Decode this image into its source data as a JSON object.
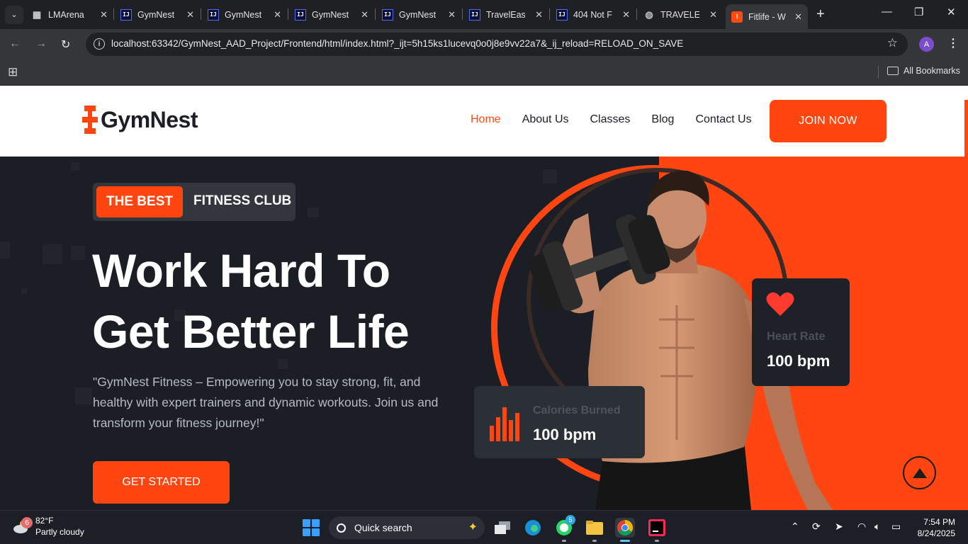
{
  "browser": {
    "tabs": [
      {
        "title": "LMArena",
        "favicon": "grid-icon"
      },
      {
        "title": "GymNest",
        "favicon": "intellij-icon"
      },
      {
        "title": "GymNest",
        "favicon": "intellij-icon"
      },
      {
        "title": "GymNest",
        "favicon": "intellij-icon"
      },
      {
        "title": "GymNest",
        "favicon": "intellij-icon"
      },
      {
        "title": "TravelEase",
        "favicon": "intellij-icon"
      },
      {
        "title": "404 Not F",
        "favicon": "intellij-icon"
      },
      {
        "title": "TRAVELER",
        "favicon": "globe-icon"
      },
      {
        "title": "Fitlife - W",
        "favicon": "fitlife-icon"
      }
    ],
    "url": "localhost:63342/GymNest_AAD_Project/Frontend/html/index.html?_ijt=5h15ks1lucevq0o0j8e9vv22a7&_ij_reload=RELOAD_ON_SAVE",
    "profile_initial": "A",
    "bookmarks_label": "All Bookmarks"
  },
  "site": {
    "brand": "GymNest",
    "nav": [
      {
        "label": "Home",
        "active": true
      },
      {
        "label": "About Us",
        "active": false
      },
      {
        "label": "Classes",
        "active": false
      },
      {
        "label": "Blog",
        "active": false
      },
      {
        "label": "Contact Us",
        "active": false
      }
    ],
    "join_label": "JOIN NOW",
    "hero": {
      "badge_highlight": "THE BEST",
      "badge_rest": "FITNESS CLUB",
      "headline_line1": "Work Hard To",
      "headline_line2": "Get Better Life",
      "lead": "\"GymNest Fitness – Empowering you to stay strong, fit, and healthy with expert trainers and dynamic workouts. Join us and transform your fitness journey!\"",
      "cta_label": "GET STARTED"
    },
    "stats": {
      "heart_rate": {
        "label": "Heart Rate",
        "value": "100 bpm"
      },
      "calories": {
        "label": "Calories Burned",
        "value": "100 bpm"
      }
    }
  },
  "taskbar": {
    "weather": {
      "temp": "82°F",
      "condition": "Partly cloudy",
      "badge": "6"
    },
    "search_placeholder": "Quick search",
    "whatsapp_badge": "5",
    "time": "7:54 PM",
    "date": "8/24/2025"
  },
  "colors": {
    "accent": "#ff4510",
    "hero_bg": "#1b1e25",
    "dark_card": "#1e2127"
  }
}
